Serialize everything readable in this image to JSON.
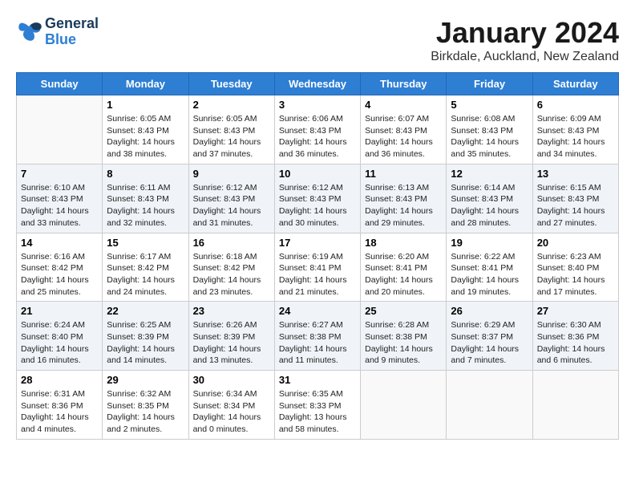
{
  "logo": {
    "line1": "General",
    "line2": "Blue"
  },
  "title": "January 2024",
  "location": "Birkdale, Auckland, New Zealand",
  "days_of_week": [
    "Sunday",
    "Monday",
    "Tuesday",
    "Wednesday",
    "Thursday",
    "Friday",
    "Saturday"
  ],
  "weeks": [
    [
      {
        "day": "",
        "info": ""
      },
      {
        "day": "1",
        "info": "Sunrise: 6:05 AM\nSunset: 8:43 PM\nDaylight: 14 hours\nand 38 minutes."
      },
      {
        "day": "2",
        "info": "Sunrise: 6:05 AM\nSunset: 8:43 PM\nDaylight: 14 hours\nand 37 minutes."
      },
      {
        "day": "3",
        "info": "Sunrise: 6:06 AM\nSunset: 8:43 PM\nDaylight: 14 hours\nand 36 minutes."
      },
      {
        "day": "4",
        "info": "Sunrise: 6:07 AM\nSunset: 8:43 PM\nDaylight: 14 hours\nand 36 minutes."
      },
      {
        "day": "5",
        "info": "Sunrise: 6:08 AM\nSunset: 8:43 PM\nDaylight: 14 hours\nand 35 minutes."
      },
      {
        "day": "6",
        "info": "Sunrise: 6:09 AM\nSunset: 8:43 PM\nDaylight: 14 hours\nand 34 minutes."
      }
    ],
    [
      {
        "day": "7",
        "info": "Sunrise: 6:10 AM\nSunset: 8:43 PM\nDaylight: 14 hours\nand 33 minutes."
      },
      {
        "day": "8",
        "info": "Sunrise: 6:11 AM\nSunset: 8:43 PM\nDaylight: 14 hours\nand 32 minutes."
      },
      {
        "day": "9",
        "info": "Sunrise: 6:12 AM\nSunset: 8:43 PM\nDaylight: 14 hours\nand 31 minutes."
      },
      {
        "day": "10",
        "info": "Sunrise: 6:12 AM\nSunset: 8:43 PM\nDaylight: 14 hours\nand 30 minutes."
      },
      {
        "day": "11",
        "info": "Sunrise: 6:13 AM\nSunset: 8:43 PM\nDaylight: 14 hours\nand 29 minutes."
      },
      {
        "day": "12",
        "info": "Sunrise: 6:14 AM\nSunset: 8:43 PM\nDaylight: 14 hours\nand 28 minutes."
      },
      {
        "day": "13",
        "info": "Sunrise: 6:15 AM\nSunset: 8:43 PM\nDaylight: 14 hours\nand 27 minutes."
      }
    ],
    [
      {
        "day": "14",
        "info": "Sunrise: 6:16 AM\nSunset: 8:42 PM\nDaylight: 14 hours\nand 25 minutes."
      },
      {
        "day": "15",
        "info": "Sunrise: 6:17 AM\nSunset: 8:42 PM\nDaylight: 14 hours\nand 24 minutes."
      },
      {
        "day": "16",
        "info": "Sunrise: 6:18 AM\nSunset: 8:42 PM\nDaylight: 14 hours\nand 23 minutes."
      },
      {
        "day": "17",
        "info": "Sunrise: 6:19 AM\nSunset: 8:41 PM\nDaylight: 14 hours\nand 21 minutes."
      },
      {
        "day": "18",
        "info": "Sunrise: 6:20 AM\nSunset: 8:41 PM\nDaylight: 14 hours\nand 20 minutes."
      },
      {
        "day": "19",
        "info": "Sunrise: 6:22 AM\nSunset: 8:41 PM\nDaylight: 14 hours\nand 19 minutes."
      },
      {
        "day": "20",
        "info": "Sunrise: 6:23 AM\nSunset: 8:40 PM\nDaylight: 14 hours\nand 17 minutes."
      }
    ],
    [
      {
        "day": "21",
        "info": "Sunrise: 6:24 AM\nSunset: 8:40 PM\nDaylight: 14 hours\nand 16 minutes."
      },
      {
        "day": "22",
        "info": "Sunrise: 6:25 AM\nSunset: 8:39 PM\nDaylight: 14 hours\nand 14 minutes."
      },
      {
        "day": "23",
        "info": "Sunrise: 6:26 AM\nSunset: 8:39 PM\nDaylight: 14 hours\nand 13 minutes."
      },
      {
        "day": "24",
        "info": "Sunrise: 6:27 AM\nSunset: 8:38 PM\nDaylight: 14 hours\nand 11 minutes."
      },
      {
        "day": "25",
        "info": "Sunrise: 6:28 AM\nSunset: 8:38 PM\nDaylight: 14 hours\nand 9 minutes."
      },
      {
        "day": "26",
        "info": "Sunrise: 6:29 AM\nSunset: 8:37 PM\nDaylight: 14 hours\nand 7 minutes."
      },
      {
        "day": "27",
        "info": "Sunrise: 6:30 AM\nSunset: 8:36 PM\nDaylight: 14 hours\nand 6 minutes."
      }
    ],
    [
      {
        "day": "28",
        "info": "Sunrise: 6:31 AM\nSunset: 8:36 PM\nDaylight: 14 hours\nand 4 minutes."
      },
      {
        "day": "29",
        "info": "Sunrise: 6:32 AM\nSunset: 8:35 PM\nDaylight: 14 hours\nand 2 minutes."
      },
      {
        "day": "30",
        "info": "Sunrise: 6:34 AM\nSunset: 8:34 PM\nDaylight: 14 hours\nand 0 minutes."
      },
      {
        "day": "31",
        "info": "Sunrise: 6:35 AM\nSunset: 8:33 PM\nDaylight: 13 hours\nand 58 minutes."
      },
      {
        "day": "",
        "info": ""
      },
      {
        "day": "",
        "info": ""
      },
      {
        "day": "",
        "info": ""
      }
    ]
  ]
}
